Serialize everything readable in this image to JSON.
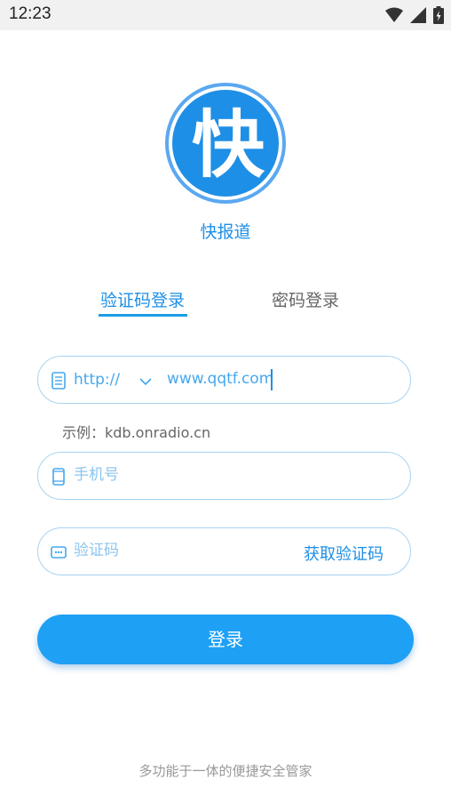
{
  "status_bar": {
    "time": "12:23",
    "icons": [
      "wifi-icon",
      "cell-signal-icon",
      "battery-icon"
    ]
  },
  "app": {
    "name": "快报道",
    "logo_glyph": "快",
    "brand_color": "#1e8fe6"
  },
  "tabs": [
    {
      "label": "验证码登录",
      "active": true
    },
    {
      "label": "密码登录",
      "active": false
    }
  ],
  "url_field": {
    "protocol": "http://",
    "value": "www.qqtf.com"
  },
  "example": "示例：kdb.onradio.cn",
  "phone_field": {
    "placeholder": "手机号"
  },
  "code_field": {
    "placeholder": "验证码",
    "get_code_label": "获取验证码"
  },
  "login_button": "登录",
  "footer": "多功能于一体的便捷安全管家"
}
